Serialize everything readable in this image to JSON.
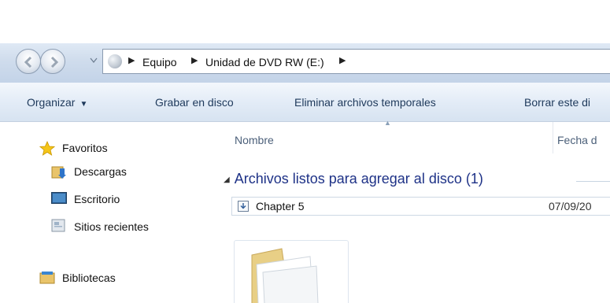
{
  "address_bar": {
    "breadcrumb": [
      "Equipo",
      "Unidad de DVD RW (E:)"
    ]
  },
  "toolbar": {
    "organize_label": "Organizar",
    "burn_label": "Grabar en disco",
    "delete_temp_label": "Eliminar archivos temporales",
    "erase_label": "Borrar este di"
  },
  "nav_pane": {
    "favorites_label": "Favoritos",
    "downloads_label": "Descargas",
    "desktop_label": "Escritorio",
    "recent_label": "Sitios recientes",
    "libraries_label": "Bibliotecas"
  },
  "file_list": {
    "columns": [
      "Nombre",
      "Fecha d"
    ],
    "group_label": "Archivos listos para agregar al disco (1)",
    "rows": [
      {
        "name": "Chapter 5",
        "date": "07/09/20"
      }
    ]
  },
  "colors": {
    "group_text": "#1e3287",
    "command_text": "#1e395b",
    "column_header_text": "#4c607a"
  }
}
